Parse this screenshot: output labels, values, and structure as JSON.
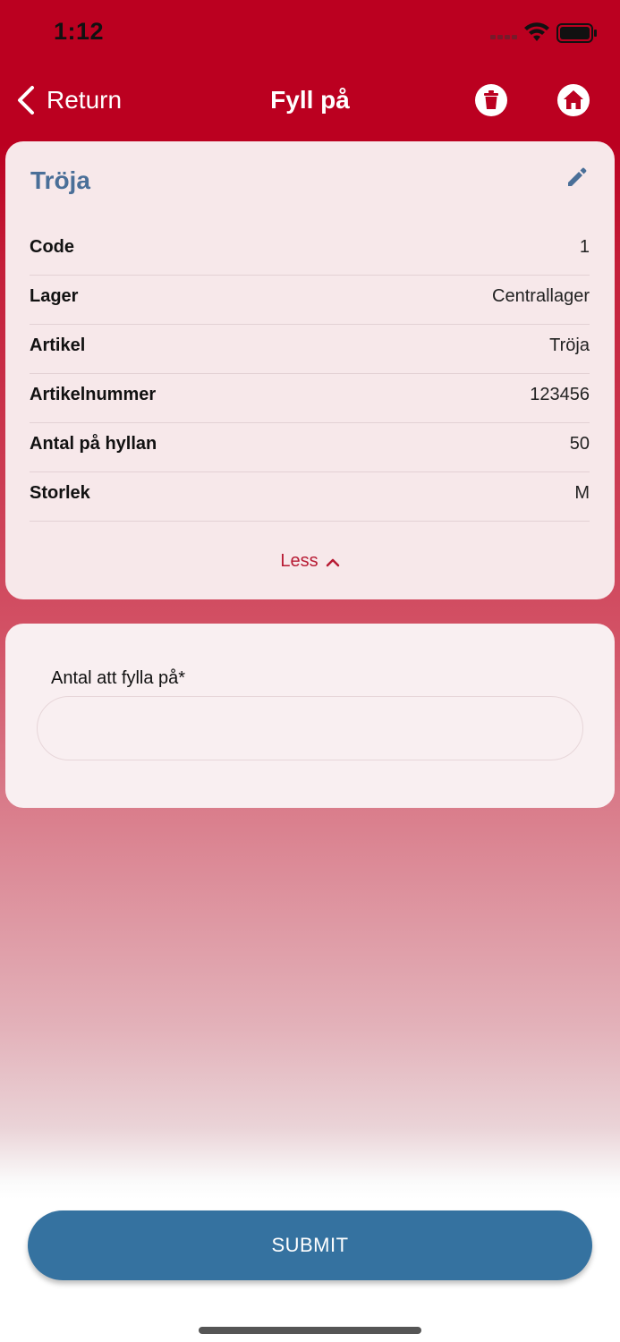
{
  "status_bar": {
    "time": "1:12"
  },
  "nav": {
    "back_label": "Return",
    "title": "Fyll på",
    "icons": {
      "back": "chevron-left-icon",
      "delete": "trash-icon",
      "home": "home-icon"
    }
  },
  "info_card": {
    "title": "Tröja",
    "rows": [
      {
        "label": "Code",
        "value": "1"
      },
      {
        "label": "Lager",
        "value": "Centrallager"
      },
      {
        "label": "Artikel",
        "value": "Tröja"
      },
      {
        "label": "Artikelnummer",
        "value": "123456"
      },
      {
        "label": "Antal på hyllan",
        "value": "50"
      },
      {
        "label": "Storlek",
        "value": "M"
      }
    ],
    "toggle_label": "Less"
  },
  "form": {
    "quantity_label": "Antal att fylla på*",
    "quantity_value": ""
  },
  "submit_label": "SUBMIT",
  "colors": {
    "header": "#bb0020",
    "card_title": "#4a6f98",
    "toggle": "#b71a33",
    "submit": "#3572a0"
  }
}
